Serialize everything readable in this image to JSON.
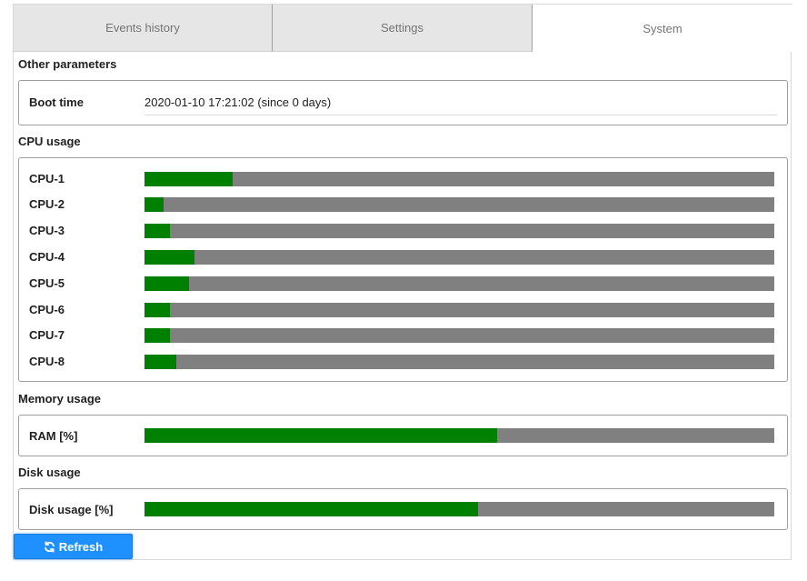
{
  "tabs": [
    {
      "label": "Events history",
      "active": false
    },
    {
      "label": "Settings",
      "active": false
    },
    {
      "label": "System",
      "active": true
    }
  ],
  "other_parameters": {
    "title": "Other parameters",
    "boot_time_label": "Boot time",
    "boot_time_value": "2020-01-10 17:21:02 (since 0 days)"
  },
  "cpu_usage": {
    "title": "CPU usage",
    "rows": [
      {
        "label": "CPU-1",
        "percent": 14
      },
      {
        "label": "CPU-2",
        "percent": 3
      },
      {
        "label": "CPU-3",
        "percent": 4
      },
      {
        "label": "CPU-4",
        "percent": 8
      },
      {
        "label": "CPU-5",
        "percent": 7
      },
      {
        "label": "CPU-6",
        "percent": 4
      },
      {
        "label": "CPU-7",
        "percent": 4
      },
      {
        "label": "CPU-8",
        "percent": 5
      }
    ]
  },
  "memory_usage": {
    "title": "Memory usage",
    "label": "RAM [%]",
    "percent": 56
  },
  "disk_usage": {
    "title": "Disk usage",
    "label": "Disk usage [%]",
    "percent": 53
  },
  "refresh_button": {
    "label": "Refresh",
    "icon": "refresh-icon"
  },
  "colors": {
    "bar_fill": "#008000",
    "bar_track": "#808080",
    "button": "#1e90ff"
  }
}
